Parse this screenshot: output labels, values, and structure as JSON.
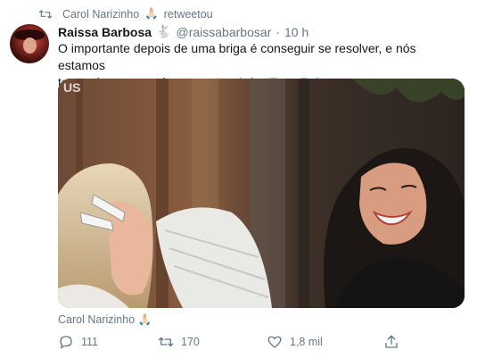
{
  "retweet_context": {
    "user": "Carol Narizinho",
    "emoji": "🙏🏻",
    "action": "retweetou"
  },
  "tweet": {
    "display_name": "Raissa Barbosa",
    "name_emoji": "🐇",
    "handle": "@raissabarbosar",
    "separator": "·",
    "time": "10 h",
    "text_line1": "O importante depois de uma briga é conseguir se resolver, e nós estamos",
    "text_line2": "torcendo para que isso aconteça!",
    "text_emoji": "🙏🏻",
    "hashtag": "#TeamRaissa"
  },
  "media": {
    "overlay_text": "US"
  },
  "media_credit": {
    "name": "Carol Narizinho",
    "emoji": "🙏🏻"
  },
  "actions": {
    "reply_icon": "reply-icon",
    "reply_count": "111",
    "retweet_icon": "retweet-icon",
    "retweet_count": "170",
    "like_icon": "heart-icon",
    "like_count": "1,8 mil",
    "share_icon": "share-icon"
  },
  "colors": {
    "link": "#1da1f2",
    "muted": "#657786",
    "text": "#14171a"
  }
}
